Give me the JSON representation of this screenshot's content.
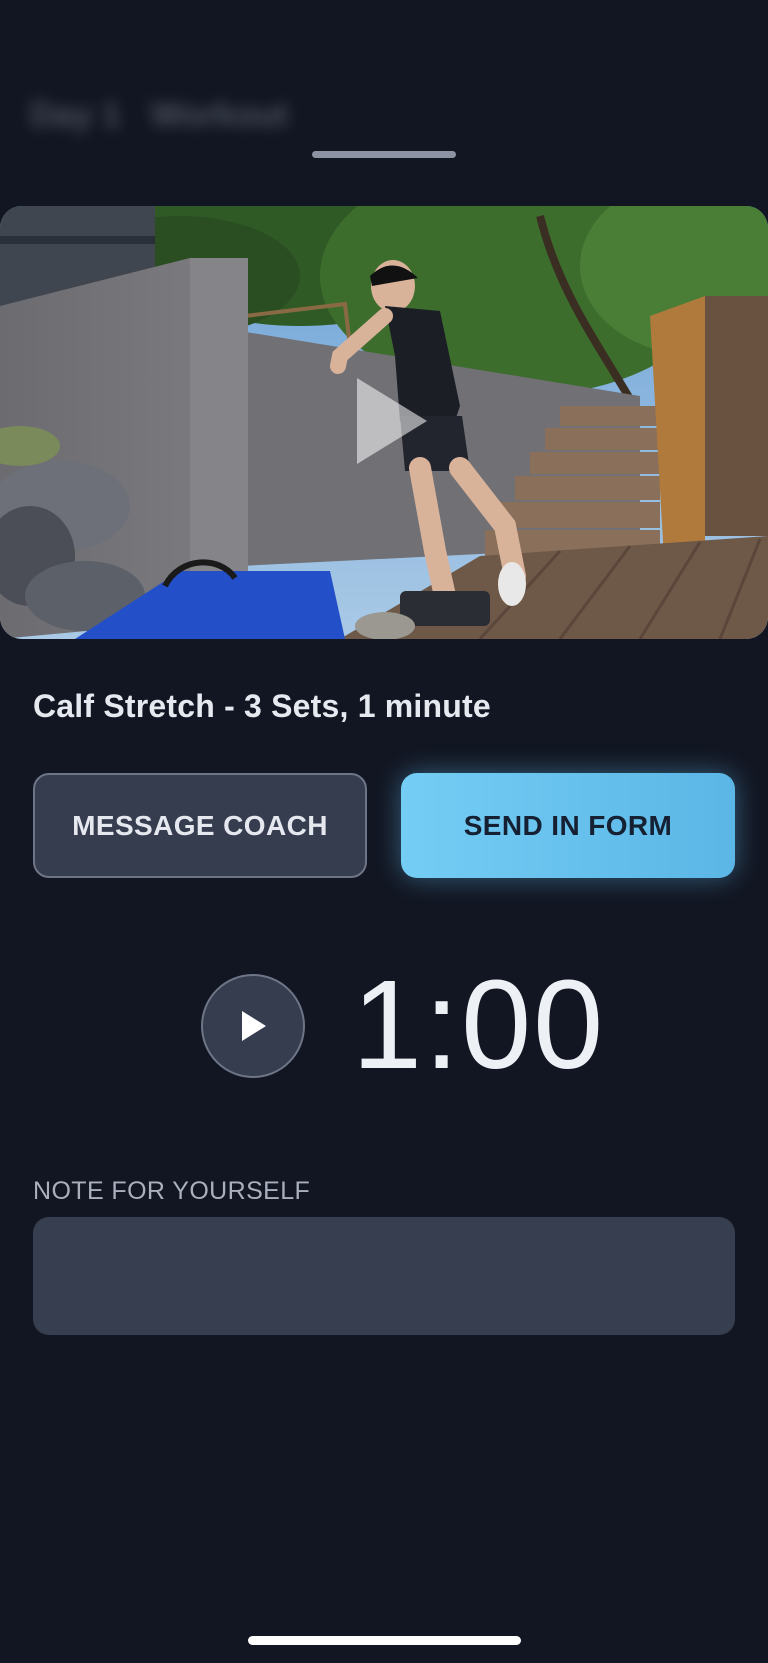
{
  "header": {
    "blurred_title_part1": "Day 1",
    "blurred_title_part2": "Workout"
  },
  "video": {
    "description_icon": "play-icon"
  },
  "exercise": {
    "title": "Calf Stretch - 3 Sets, 1 minute"
  },
  "actions": {
    "message_coach_label": "MESSAGE COACH",
    "send_form_label": "SEND IN FORM"
  },
  "timer": {
    "value": "1:00",
    "play_icon": "play-icon"
  },
  "note": {
    "label": "NOTE FOR YOURSELF",
    "value": "",
    "placeholder": ""
  },
  "colors": {
    "background": "#121622",
    "accent": "#6cc4f0",
    "button_dark": "#363d4f"
  }
}
